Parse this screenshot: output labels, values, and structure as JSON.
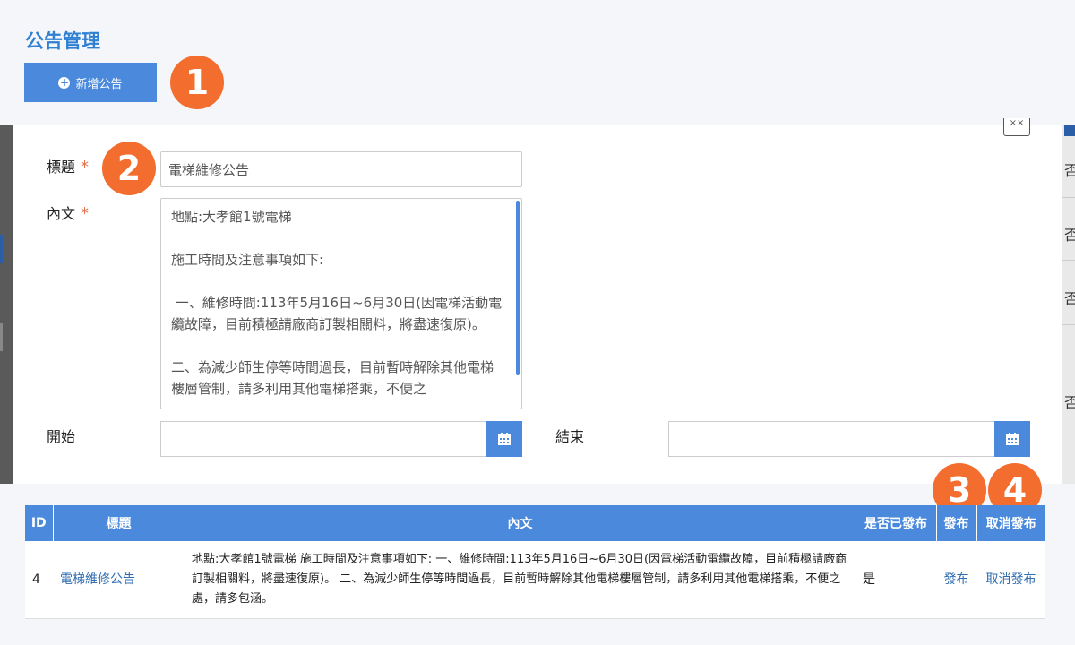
{
  "page": {
    "title": "公告管理",
    "add_button_label": "新增公告",
    "badges": [
      "1",
      "2",
      "3",
      "4"
    ]
  },
  "form": {
    "title_label": "標題",
    "required_mark": "*",
    "title_value": "電梯維修公告",
    "content_label": "內文",
    "content_value": "地點:大孝館1號電梯\n\n施工時間及注意事項如下:\n\n 一、維修時間:113年5月16日~6月30日(因電梯活動電纜故障，目前積極請廠商訂製相關料，將盡速復原)。\n\n二、為減少師生停等時間過長，目前暫時解除其他電梯樓層管制，請多利用其他電梯搭乘，不便之",
    "start_label": "開始",
    "end_label": "結束",
    "start_value": "",
    "end_value": ""
  },
  "background": {
    "right_chars": [
      "否",
      "否",
      "否",
      "否"
    ]
  },
  "table": {
    "headers": {
      "id": "ID",
      "title": "標題",
      "content": "內文",
      "published": "是否已發布",
      "publish": "發布",
      "unpublish": "取消發布"
    },
    "rows": [
      {
        "id": "4",
        "title": "電梯維修公告",
        "content": "地點:大孝館1號電梯 施工時間及注意事項如下: 一、維修時間:113年5月16日~6月30日(因電梯活動電纜故障，目前積極請廠商訂製相關料，將盡速復原)。 二、為減少師生停等時間過長，目前暫時解除其他電梯樓層管制，請多利用其他電梯搭乘，不便之處，請多包涵。",
        "published": "是",
        "publish": "發布",
        "unpublish": "取消發布"
      }
    ]
  },
  "colors": {
    "accent": "#4a89dc",
    "title": "#2f7fd3",
    "badge": "#f36d2f",
    "required": "#e2704a",
    "link": "#2f6db0"
  }
}
